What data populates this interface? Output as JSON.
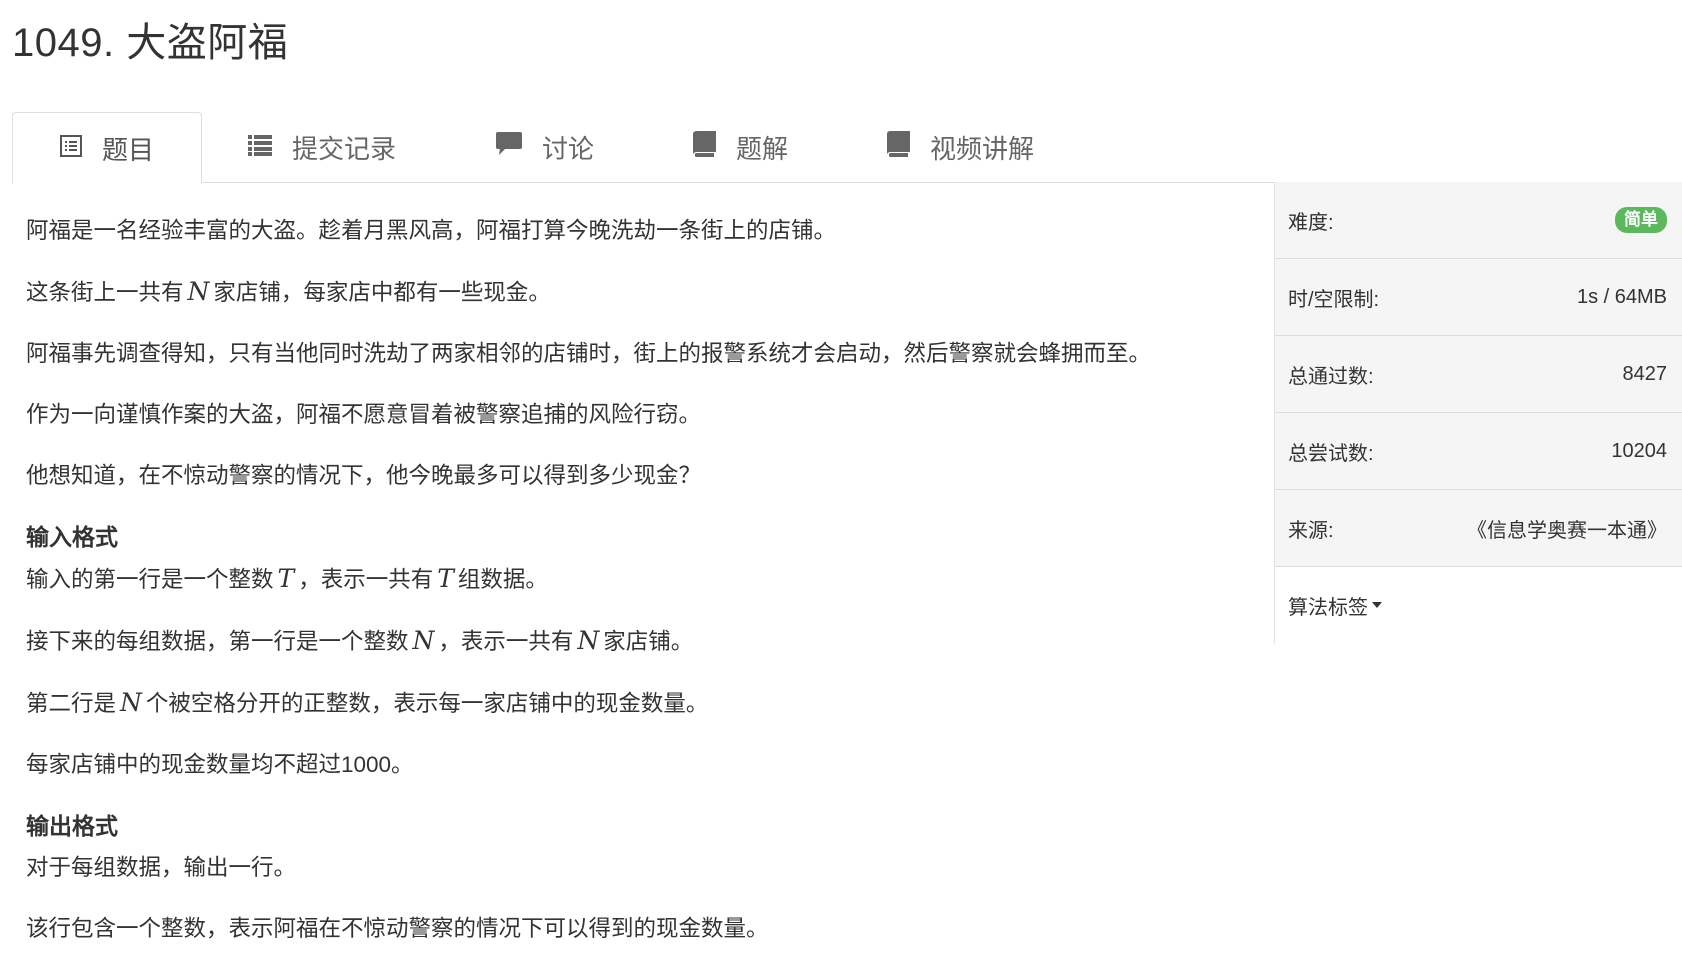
{
  "problem": {
    "title": "1049. 大盗阿福"
  },
  "tabs": [
    {
      "label": "题目",
      "icon": "list-alt-icon",
      "active": true
    },
    {
      "label": "提交记录",
      "icon": "list-icon",
      "active": false
    },
    {
      "label": "讨论",
      "icon": "comment-icon",
      "active": false
    },
    {
      "label": "题解",
      "icon": "book-icon",
      "active": false
    },
    {
      "label": "视频讲解",
      "icon": "book-icon",
      "active": false
    }
  ],
  "content": {
    "desc": [
      "阿福是一名经验丰富的大盗。趁着月黑风高，阿福打算今晚洗劫一条街上的店铺。",
      {
        "pre": "这条街上一共有",
        "var": "N",
        "post": "家店铺，每家店中都有一些现金。"
      },
      "阿福事先调查得知，只有当他同时洗劫了两家相邻的店铺时，街上的报警系统才会启动，然后警察就会蜂拥而至。",
      "作为一向谨慎作案的大盗，阿福不愿意冒着被警察追捕的风险行窃。",
      "他想知道，在不惊动警察的情况下，他今晚最多可以得到多少现金？"
    ],
    "input_heading": "输入格式",
    "input": {
      "line1": {
        "pre": "输入的第一行是一个整数",
        "var1": "T",
        "mid": "，表示一共有",
        "var2": "T",
        "post": "组数据。"
      },
      "line2": {
        "pre": "接下来的每组数据，第一行是一个整数",
        "var1": "N",
        "mid": "，表示一共有",
        "var2": "N",
        "post": "家店铺。"
      },
      "line3": {
        "pre": "第二行是",
        "var": "N",
        "post": "个被空格分开的正整数，表示每一家店铺中的现金数量。"
      },
      "line4": "每家店铺中的现金数量均不超过1000。"
    },
    "output_heading": "输出格式",
    "output": [
      "对于每组数据，输出一行。",
      "该行包含一个整数，表示阿福在不惊动警察的情况下可以得到的现金数量。"
    ]
  },
  "sidebar": {
    "difficulty_label": "难度:",
    "difficulty_value": "简单",
    "difficulty_color": "#5cb85c",
    "limit_label": "时/空限制:",
    "limit_value": "1s / 64MB",
    "passed_label": "总通过数:",
    "passed_value": "8427",
    "tried_label": "总尝试数:",
    "tried_value": "10204",
    "source_label": "来源:",
    "source_value": "《信息学奥赛一本通》",
    "tags_label": "算法标签"
  }
}
